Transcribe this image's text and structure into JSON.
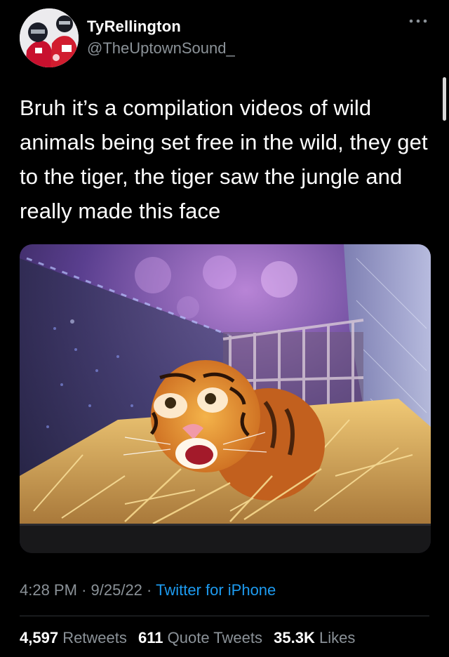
{
  "tweet": {
    "display_name": "TyRellington",
    "handle": "@TheUptownSound_",
    "text": "Bruh it’s a compilation videos of wild animals being set free in the wild, they get to the tiger, the tiger saw the jungle and really made this face",
    "time": "4:28 PM",
    "date": "9/25/22",
    "separator": "·",
    "source": "Twitter for iPhone",
    "more_icon": "more-horizontal-icon"
  },
  "stats": {
    "retweets_count": "4,597",
    "retweets_label": "Retweets",
    "quote_count": "611",
    "quote_label": "Quote Tweets",
    "likes_count": "35.3K",
    "likes_label": "Likes"
  },
  "colors": {
    "background": "#000000",
    "text": "#ffffff",
    "secondary": "#8b9298",
    "link": "#1d9bf0",
    "divider": "#2f3336"
  }
}
